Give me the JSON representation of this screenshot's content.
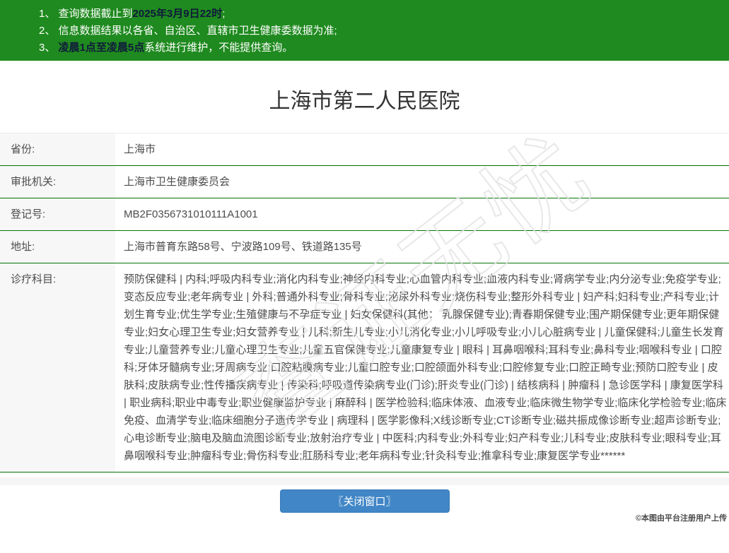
{
  "banner": {
    "notices": [
      {
        "prefix": "1、 查询数据截止到",
        "bold": "2025年3月9日22时",
        "suffix": ";"
      },
      {
        "prefix": "2、 信息数据结果以各省、自治区、直辖市卫生健康委数据为准;",
        "bold": "",
        "suffix": ""
      },
      {
        "prefix": "3、 ",
        "bold": "凌晨1点至凌晨5点",
        "suffix": "系统进行维护，不能提供查询。"
      }
    ]
  },
  "page": {
    "title": "上海市第二人民医院"
  },
  "details": {
    "rows": [
      {
        "label": "省份:",
        "value": "上海市"
      },
      {
        "label": "审批机关:",
        "value": "上海市卫生健康委员会"
      },
      {
        "label": "登记号:",
        "value": "MB2F0356731010111A1001"
      },
      {
        "label": "地址:",
        "value": "上海市普育东路58号、宁波路109号、铁道路135号"
      },
      {
        "label": "诊疗科目:",
        "value": "预防保健科 | 内科;呼吸内科专业;消化内科专业;神经内科专业;心血管内科专业;血液内科专业;肾病学专业;内分泌专业;免疫学专业;变态反应专业;老年病专业 | 外科;普通外科专业;骨科专业;泌尿外科专业;烧伤科专业;整形外科专业 | 妇产科;妇科专业;产科专业;计划生育专业;优生学专业;生殖健康与不孕症专业 | 妇女保健科(其他： 乳腺保健专业);青春期保健专业;围产期保健专业;更年期保健专业;妇女心理卫生专业;妇女营养专业 | 儿科;新生儿专业;小儿消化专业;小儿呼吸专业;小儿心脏病专业 | 儿童保健科;儿童生长发育专业;儿童营养专业;儿童心理卫生专业;儿童五官保健专业;儿童康复专业 | 眼科 | 耳鼻咽喉科;耳科专业;鼻科专业;咽喉科专业 | 口腔科;牙体牙髓病专业;牙周病专业;口腔粘膜病专业;儿童口腔专业;口腔颌面外科专业;口腔修复专业;口腔正畸专业;预防口腔专业 | 皮肤科;皮肤病专业;性传播疾病专业 | 传染科;呼吸道传染病专业(门诊);肝炎专业(门诊) | 结核病科 | 肿瘤科 | 急诊医学科 | 康复医学科 | 职业病科;职业中毒专业;职业健康监护专业 | 麻醉科 | 医学检验科;临床体液、血液专业;临床微生物学专业;临床化学检验专业;临床免疫、血清学专业;临床细胞分子遗传学专业 | 病理科 | 医学影像科;X线诊断专业;CT诊断专业;磁共振成像诊断专业;超声诊断专业;心电诊断专业;脑电及脑血流图诊断专业;放射治疗专业 | 中医科;内科专业;外科专业;妇产科专业;儿科专业;皮肤科专业;眼科专业;耳鼻咽喉科专业;肿瘤科专业;骨伤科专业;肛肠科专业;老年病科专业;针灸科专业;推拿科专业;康复医学专业******"
      }
    ]
  },
  "footer": {
    "close_button": "〖关闭窗口〗"
  },
  "watermark": "查证无忧",
  "credit": "©本图由平台注册用户上传",
  "colors": {
    "banner_green": "#1f8a1f",
    "divider_green": "#067306",
    "button_blue": "#4186c6",
    "banner_highlight": "#101a3c"
  }
}
